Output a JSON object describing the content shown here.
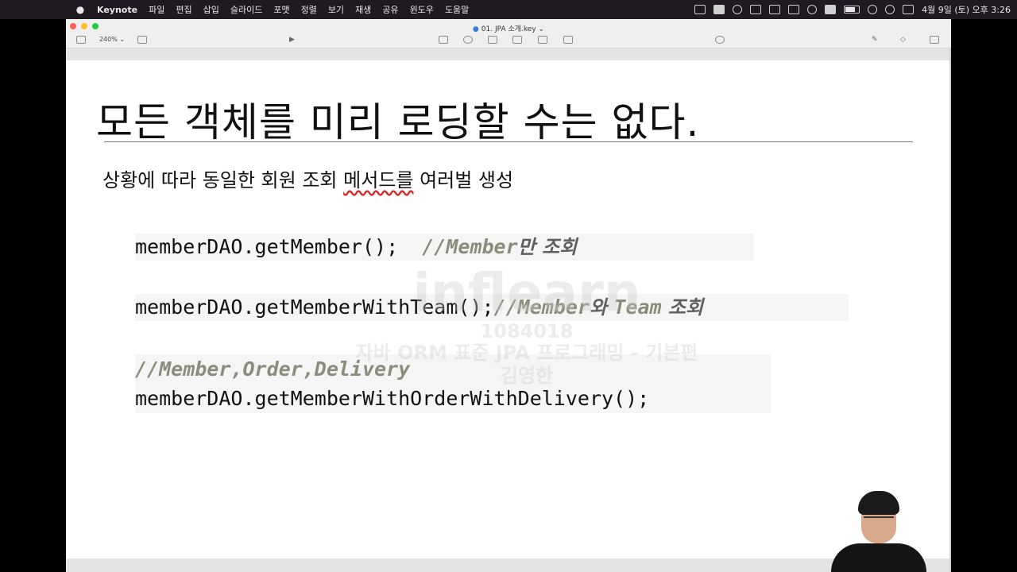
{
  "menubar": {
    "app_name": "Keynote",
    "items": [
      "파일",
      "편집",
      "삽입",
      "슬라이드",
      "포맷",
      "정렬",
      "보기",
      "재생",
      "공유",
      "윈도우",
      "도움말"
    ],
    "clock": "4월 9일 (토) 오후 3:26"
  },
  "window": {
    "doc_title": "01. JPA 소개.key",
    "zoom": "240%"
  },
  "slide": {
    "title": "모든 객체를 미리 로딩할 수는 없다.",
    "subtitle_prefix": "상황에 따라 동일한 회원 조회 ",
    "subtitle_typo": "메서드를",
    "subtitle_suffix": " 여러벌 생성",
    "code": {
      "line1_code": "memberDAO.getMember(); ",
      "line1_comment": "//Member",
      "line1_comment_ko": "만 조회",
      "line2_code": "memberDAO.getMemberWithTeam();",
      "line2_comment": "//Member",
      "line2_comment_ko": "와 ",
      "line2_comment2": "Team",
      "line2_comment_ko2": " 조회",
      "line3_comment": "//Member,Order,Delivery",
      "line3_code": "memberDAO.getMemberWithOrderWithDelivery();"
    }
  },
  "watermark": {
    "logo": "inflearn",
    "id": "1084018",
    "course": "자바 ORM 표준 JPA 프로그래밍 - 기본편",
    "name": "김영한"
  },
  "colors": {
    "comment": "#8c8c7c",
    "traffic_close": "#fe5f57",
    "traffic_min": "#febc2e",
    "traffic_max": "#28c840"
  }
}
